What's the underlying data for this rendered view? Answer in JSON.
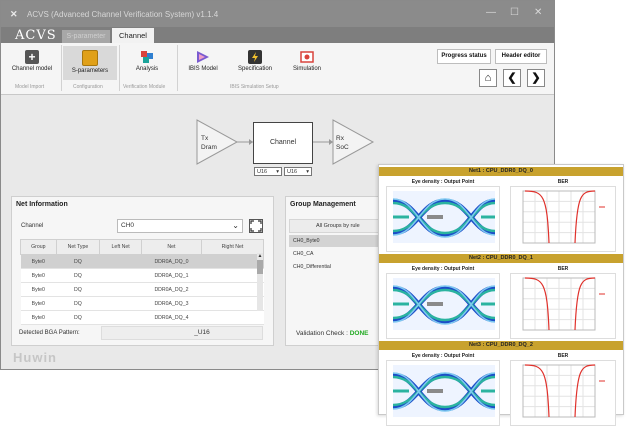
{
  "window": {
    "logo_glyph": "✕",
    "title": "ACVS (Advanced Channel Verification System) v1.1.4",
    "brand": "ACVS",
    "controls": {
      "minimize": "—",
      "maximize": "☐",
      "close": "✕"
    }
  },
  "tabs": [
    {
      "label": "S-parameter"
    },
    {
      "label": "Channel"
    }
  ],
  "ribbon": {
    "buttons": [
      {
        "label": "Channel model",
        "icon": "plus-icon",
        "color": "#555555"
      },
      {
        "label": "S-parameters",
        "icon": "sparam-icon",
        "color": "#e0a018"
      },
      {
        "label": "Analysis",
        "icon": "analysis-icon",
        "color": "#d9433c"
      },
      {
        "label": "IBIS Model",
        "icon": "ibis-icon",
        "color": "#7a5bd0"
      },
      {
        "label": "Specification",
        "icon": "spec-icon",
        "color": "#333333"
      },
      {
        "label": "Simulation",
        "icon": "simulation-icon",
        "color": "#d9433c"
      }
    ],
    "groups": [
      "Model Import",
      "Configuration",
      "Verification Module",
      "IBIS Simulation Setup"
    ],
    "progress_label": "Progress status",
    "header_editor_label": "Header editor",
    "nav": {
      "home": "⌂",
      "back": "❮",
      "forward": "❯"
    }
  },
  "diagram": {
    "tx_label": "Tx\nDram",
    "channel_label": "Channel",
    "rx_label": "Rx\nSoC",
    "select_left": "U16",
    "select_right": "U16"
  },
  "net_info": {
    "title": "Net Information",
    "channel_label": "Channel",
    "channel_value": "CH0",
    "columns": [
      "Group",
      "Net Type",
      "Left Net",
      "Net",
      "Right Net"
    ],
    "rows": [
      [
        "Byte0",
        "DQ",
        "",
        "DDR0A_DQ_0",
        ""
      ],
      [
        "Byte0",
        "DQ",
        "",
        "DDR0A_DQ_1",
        ""
      ],
      [
        "Byte0",
        "DQ",
        "",
        "DDR0A_DQ_2",
        ""
      ],
      [
        "Byte0",
        "DQ",
        "",
        "DDR0A_DQ_3",
        ""
      ],
      [
        "Byte0",
        "DQ",
        "",
        "DDR0A_DQ_4",
        ""
      ]
    ],
    "bga_label": "Detected BGA Pattern:",
    "bga_value": "_U16"
  },
  "group_mgmt": {
    "title": "Group Management",
    "header": "All Groups by rule",
    "items": [
      "CH0_Byte0",
      "CH0_CA",
      "CH0_Differential"
    ],
    "validation_label": "Validation Check :",
    "validation_value": "DONE",
    "validation_color": "#22aa22"
  },
  "results": [
    {
      "net": "Net1 : CPU_DDR0_DQ_0",
      "eye_title": "Eye density : Output Point",
      "ber_title": "BER"
    },
    {
      "net": "Net2 : CPU_DDR0_DQ_1",
      "eye_title": "Eye density : Output Point",
      "ber_title": "BER"
    },
    {
      "net": "Net3 : CPU_DDR0_DQ_2",
      "eye_title": "Eye density : Output Point",
      "ber_title": "BER"
    }
  ],
  "watermark": "Huwin"
}
